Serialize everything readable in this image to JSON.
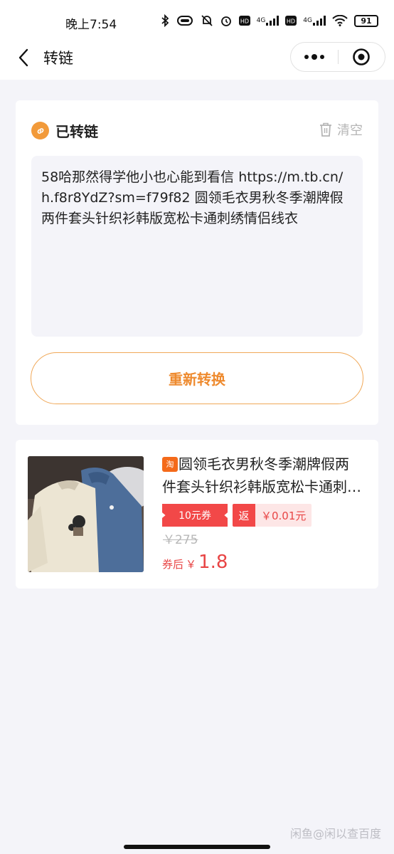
{
  "status_bar": {
    "time": "晚上7:54",
    "battery": "91",
    "net_a": "4G",
    "net_b": "4G",
    "icons": [
      "bluetooth-icon",
      "vibrate-icon",
      "mute-icon",
      "alarm-icon",
      "hd-icon",
      "signal-icon",
      "hd-icon",
      "signal-icon",
      "wifi-icon",
      "battery-icon"
    ]
  },
  "nav": {
    "title": "转链",
    "back_icon": "chevron-left-icon",
    "more_icon": "more-dots-icon",
    "close_icon": "target-icon"
  },
  "converted": {
    "title": "已转链",
    "clear_label": "清空",
    "text": "58哈那然得学他小也心能到看信 https://m.tb.cn/h.f8r8YdZ?sm=f79f82  圆领毛衣男秋冬季潮牌假两件套头针织衫韩版宽松卡通刺绣情侣线衣",
    "convert_button": "重新转换"
  },
  "product": {
    "platform_badge": "淘",
    "title": "圆领毛衣男秋冬季潮牌假两件套头针织衫韩版宽松卡通刺绣情侣线衣",
    "coupon": "10元券",
    "rebate_tag": "返",
    "rebate_amount": "￥0.01元",
    "original_price": "￥275",
    "final_label": "券后",
    "final_currency": "￥",
    "final_price": "1.8"
  },
  "watermark": "闲鱼@闲以查百度",
  "colors": {
    "accent": "#ee8a2e",
    "price_red": "#e84545",
    "background": "#f4f4f9"
  }
}
